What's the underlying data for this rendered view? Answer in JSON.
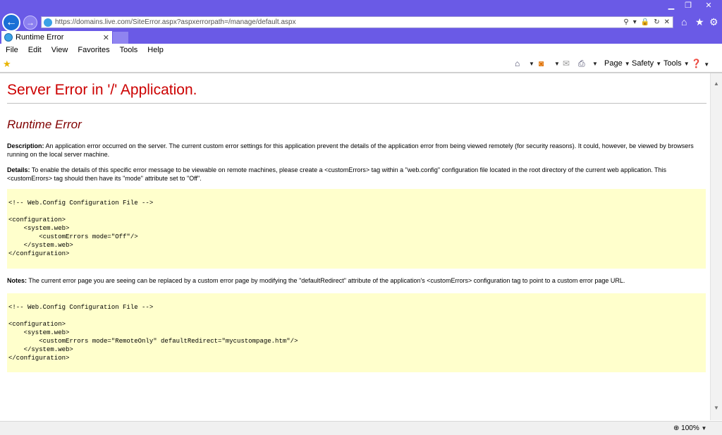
{
  "browser": {
    "url": "https://domains.live.com/SiteError.aspx?aspxerrorpath=/manage/default.aspx",
    "tab_title": "Runtime Error",
    "menu": [
      "File",
      "Edit",
      "View",
      "Favorites",
      "Tools",
      "Help"
    ],
    "commands": {
      "page": "Page",
      "safety": "Safety",
      "tools": "Tools"
    },
    "zoom": "100%",
    "icons": [
      "back-icon",
      "forward-icon",
      "search-icon",
      "lock-icon",
      "refresh-icon",
      "home-icon",
      "favorites-star-icon",
      "gear-icon",
      "rss-icon",
      "mail-icon",
      "print-icon",
      "help-icon",
      "zoom-icon"
    ]
  },
  "page": {
    "heading": "Server Error in '/' Application.",
    "subheading": "Runtime Error",
    "description_label": "Description:",
    "description_text": " An application error occurred on the server. The current custom error settings for this application prevent the details of the application error from being viewed remotely (for security reasons). It could, however, be viewed by browsers running on the local server machine.",
    "details_label": "Details:",
    "details_text": " To enable the details of this specific error message to be viewable on remote machines, please create a <customErrors> tag within a \"web.config\" configuration file located in the root directory of the current web application. This <customErrors> tag should then have its \"mode\" attribute set to \"Off\".",
    "code1": "<!-- Web.Config Configuration File -->\n\n<configuration>\n    <system.web>\n        <customErrors mode=\"Off\"/>\n    </system.web>\n</configuration>",
    "notes_label": "Notes:",
    "notes_text": " The current error page you are seeing can be replaced by a custom error page by modifying the \"defaultRedirect\" attribute of the application's <customErrors> configuration tag to point to a custom error page URL.",
    "code2": "<!-- Web.Config Configuration File -->\n\n<configuration>\n    <system.web>\n        <customErrors mode=\"RemoteOnly\" defaultRedirect=\"mycustompage.htm\"/>\n    </system.web>\n</configuration>"
  },
  "colors": {
    "chrome": "#6a5ae6",
    "heading": "#cc0000",
    "subheading": "#800000",
    "code_bg": "#ffffcc"
  }
}
